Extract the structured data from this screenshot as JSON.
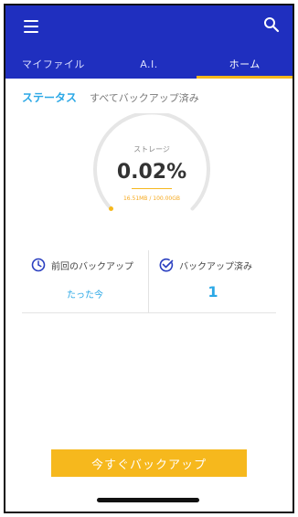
{
  "header": {
    "menu_icon": "hamburger-menu-icon",
    "search_icon": "search-icon",
    "tabs": [
      {
        "label": "マイファイル",
        "active": false
      },
      {
        "label": "A.I.",
        "active": false
      },
      {
        "label": "ホーム",
        "active": true
      }
    ]
  },
  "status": {
    "label": "ステータス",
    "text": "すべてバックアップ済み"
  },
  "storage": {
    "title": "ストレージ",
    "percent": "0.02%",
    "percent_value": 0.02,
    "detail": "16.51MB / 100.00GB"
  },
  "last_backup": {
    "icon": "clock-icon",
    "label": "前回のバックアップ",
    "value": "たった今"
  },
  "backed_up": {
    "icon": "check-circle-icon",
    "label": "バックアップ済み",
    "value": "1"
  },
  "backup_button": {
    "label": "今すぐバックアップ"
  },
  "colors": {
    "appbar": "#1f2fbf",
    "accent_yellow": "#f6b81d",
    "accent_blue": "#2ba8e6"
  }
}
